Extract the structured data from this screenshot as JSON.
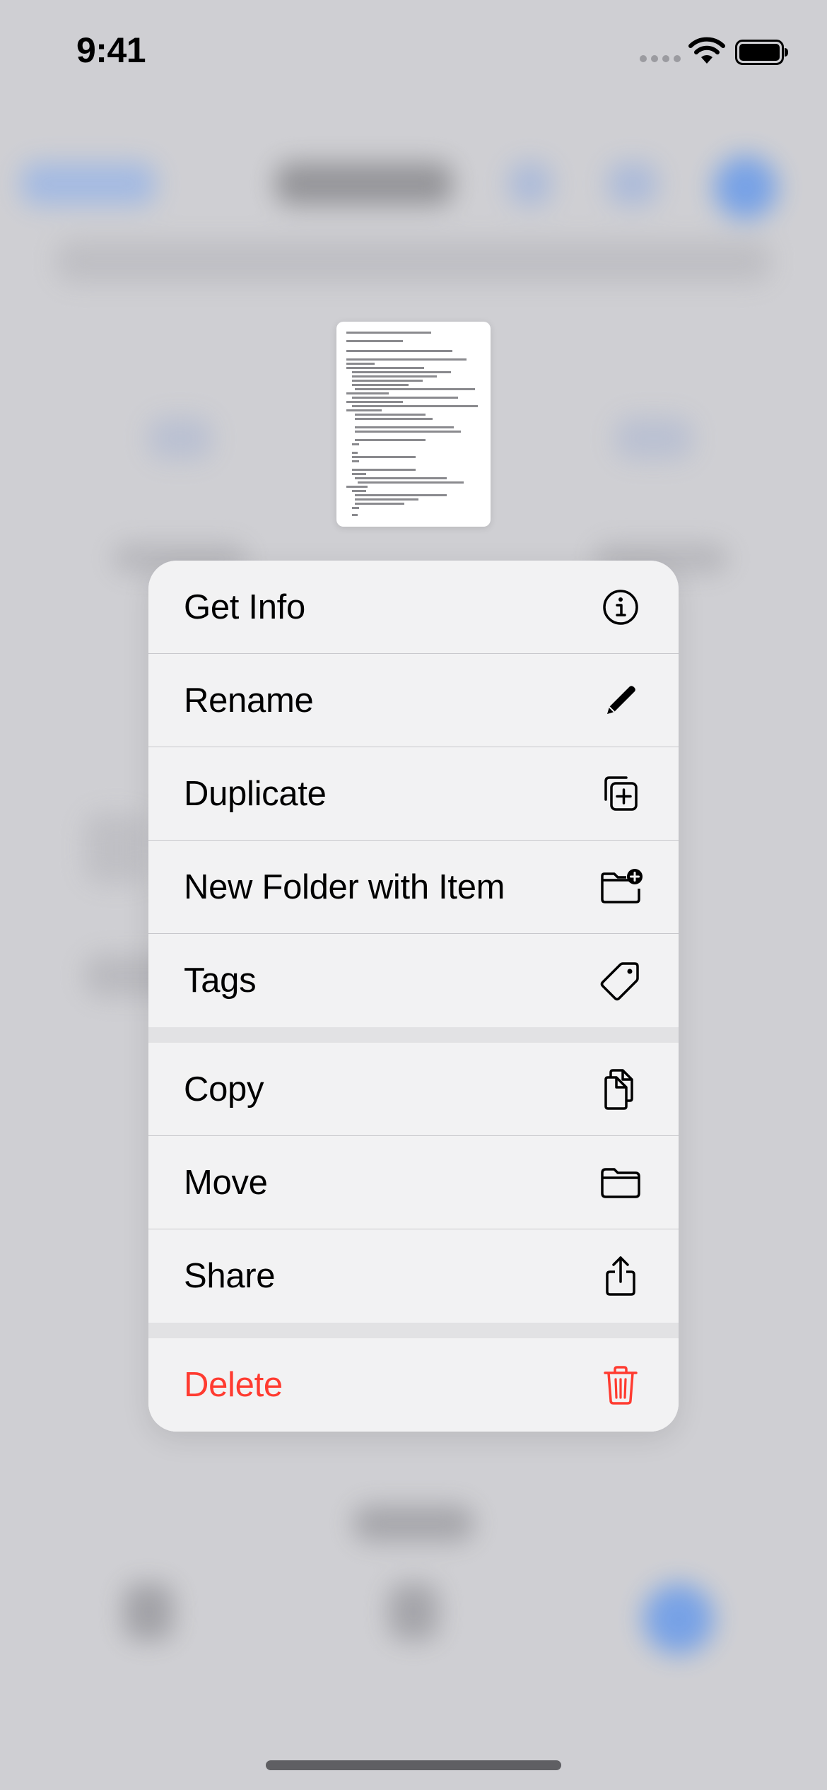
{
  "status_bar": {
    "time": "9:41"
  },
  "menu": {
    "items": [
      {
        "label": "Get Info",
        "icon": "info-circle-icon"
      },
      {
        "label": "Rename",
        "icon": "pencil-icon"
      },
      {
        "label": "Duplicate",
        "icon": "duplicate-icon"
      },
      {
        "label": "New Folder with Item",
        "icon": "folder-plus-icon"
      },
      {
        "label": "Tags",
        "icon": "tag-icon"
      },
      {
        "label": "Copy",
        "icon": "copy-documents-icon"
      },
      {
        "label": "Move",
        "icon": "folder-icon"
      },
      {
        "label": "Share",
        "icon": "share-icon"
      },
      {
        "label": "Delete",
        "icon": "trash-icon"
      }
    ]
  },
  "colors": {
    "destructive": "#ff3b30",
    "menu_background": "#f2f2f3",
    "backdrop": "#cfcfd3"
  }
}
